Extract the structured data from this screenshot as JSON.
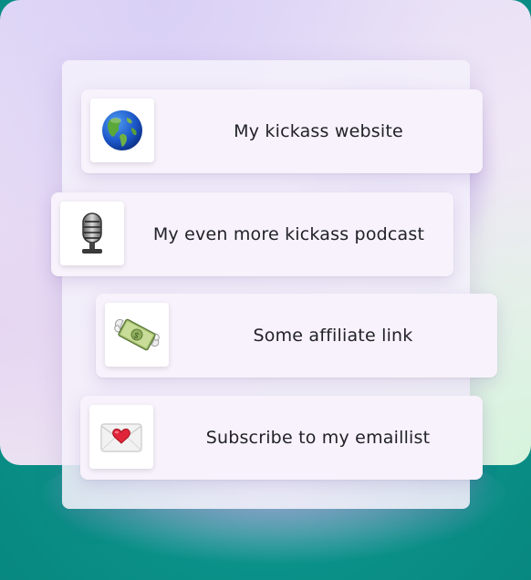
{
  "links": [
    {
      "label": "My kickass website",
      "icon": "globe-icon"
    },
    {
      "label": "My even more kickass podcast",
      "icon": "microphone-icon"
    },
    {
      "label": "Some affiliate link",
      "icon": "money-with-wings-icon"
    },
    {
      "label": "Subscribe to my emaillist",
      "icon": "envelope-with-heart-icon"
    }
  ],
  "colors": {
    "outer_background": "#0f9c93",
    "card_background": "#f7f2fb",
    "text": "#222228"
  }
}
